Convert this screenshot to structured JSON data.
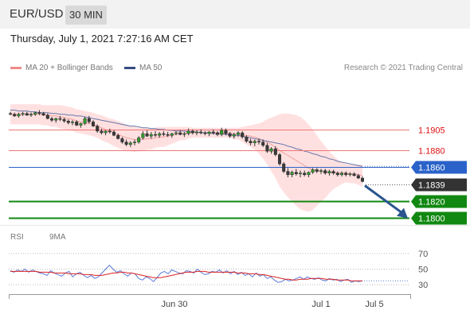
{
  "header": {
    "pair": "EUR/USD",
    "timeframe": "30 MIN"
  },
  "datetime": "Thursday, July 1, 2021 7:27:16 AM CET",
  "legend": {
    "ma_bollinger": "MA 20 + Bollinger Bands",
    "ma50": "MA 50",
    "credit": "Research © 2021 Trading Central"
  },
  "rsi_legend": {
    "rsi": "RSI",
    "ma": "9MA"
  },
  "colors": {
    "up": "#2e9b2e",
    "down": "#3a3a3a",
    "resistance": "#ee7777",
    "pivot": "#2a62c9",
    "support": "#118811",
    "current": "#333333",
    "bollinger_fill": "#ffd6d6",
    "ma50": "#6677aa",
    "rsi_line": "#5b7bd5",
    "rsi_ma": "#dd2222",
    "arrow": "#2a5590"
  },
  "chart_data": {
    "type": "candlestick",
    "x_ticks": [
      "Jun 30",
      "Jul 1",
      "Jul 5"
    ],
    "y_ticks": [
      "1.1905",
      "1.1880",
      "1.1860",
      "1.1839",
      "1.1820",
      "1.1800"
    ],
    "ylim": [
      1.1794,
      1.1955
    ],
    "levels": [
      {
        "label": "1.1905",
        "value": 1.1905,
        "kind": "resistance"
      },
      {
        "label": "1.1880",
        "value": 1.188,
        "kind": "resistance"
      },
      {
        "label": "1.1860",
        "value": 1.186,
        "kind": "pivot"
      },
      {
        "label": "1.1839",
        "value": 1.1839,
        "kind": "current"
      },
      {
        "label": "1.1820",
        "value": 1.182,
        "kind": "support"
      },
      {
        "label": "1.1800",
        "value": 1.18,
        "kind": "support"
      }
    ],
    "candles": [
      [
        1.1924,
        1.1926,
        1.1922,
        1.1923
      ],
      [
        1.1923,
        1.1925,
        1.192,
        1.1921
      ],
      [
        1.1921,
        1.1925,
        1.1919,
        1.1923
      ],
      [
        1.1923,
        1.1926,
        1.1921,
        1.1924
      ],
      [
        1.1924,
        1.1926,
        1.1921,
        1.1922
      ],
      [
        1.1922,
        1.1925,
        1.192,
        1.1923
      ],
      [
        1.1923,
        1.1926,
        1.1921,
        1.1925
      ],
      [
        1.1925,
        1.1928,
        1.1922,
        1.1924
      ],
      [
        1.1924,
        1.1926,
        1.1921,
        1.1922
      ],
      [
        1.1922,
        1.1924,
        1.1917,
        1.1918
      ],
      [
        1.1918,
        1.192,
        1.1914,
        1.1916
      ],
      [
        1.1916,
        1.1919,
        1.1913,
        1.1918
      ],
      [
        1.1918,
        1.1921,
        1.1915,
        1.1917
      ],
      [
        1.1917,
        1.1919,
        1.1913,
        1.1915
      ],
      [
        1.1915,
        1.1917,
        1.1911,
        1.1913
      ],
      [
        1.1913,
        1.1916,
        1.191,
        1.1914
      ],
      [
        1.1914,
        1.1916,
        1.1909,
        1.191
      ],
      [
        1.191,
        1.1913,
        1.1907,
        1.1912
      ],
      [
        1.1912,
        1.192,
        1.191,
        1.1918
      ],
      [
        1.1918,
        1.1921,
        1.1912,
        1.1914
      ],
      [
        1.1914,
        1.1916,
        1.1908,
        1.1909
      ],
      [
        1.1909,
        1.1911,
        1.1901,
        1.1903
      ],
      [
        1.1903,
        1.1906,
        1.1899,
        1.1901
      ],
      [
        1.1901,
        1.1904,
        1.1898,
        1.1903
      ],
      [
        1.1903,
        1.1906,
        1.19,
        1.1902
      ],
      [
        1.1902,
        1.1904,
        1.1897,
        1.1898
      ],
      [
        1.1898,
        1.19,
        1.1893,
        1.1894
      ],
      [
        1.1894,
        1.1896,
        1.1888,
        1.189
      ],
      [
        1.189,
        1.1893,
        1.1885,
        1.1887
      ],
      [
        1.1887,
        1.1891,
        1.1884,
        1.1889
      ],
      [
        1.1889,
        1.1893,
        1.1886,
        1.189
      ],
      [
        1.189,
        1.1897,
        1.1888,
        1.1895
      ],
      [
        1.1895,
        1.1903,
        1.1893,
        1.19
      ],
      [
        1.19,
        1.1904,
        1.1896,
        1.1897
      ],
      [
        1.1897,
        1.1902,
        1.1894,
        1.1899
      ],
      [
        1.1899,
        1.1903,
        1.1896,
        1.1898
      ],
      [
        1.1898,
        1.1902,
        1.1895,
        1.19
      ],
      [
        1.19,
        1.1903,
        1.1897,
        1.1899
      ],
      [
        1.1899,
        1.1902,
        1.1896,
        1.1898
      ],
      [
        1.1898,
        1.1901,
        1.1895,
        1.19
      ],
      [
        1.19,
        1.1903,
        1.1898,
        1.1901
      ],
      [
        1.1901,
        1.1904,
        1.1898,
        1.1899
      ],
      [
        1.1899,
        1.1902,
        1.1896,
        1.19
      ],
      [
        1.19,
        1.1906,
        1.1898,
        1.1903
      ],
      [
        1.1903,
        1.1905,
        1.1899,
        1.1901
      ],
      [
        1.1901,
        1.1904,
        1.1898,
        1.1902
      ],
      [
        1.1902,
        1.1905,
        1.1899,
        1.1901
      ],
      [
        1.1901,
        1.1903,
        1.1898,
        1.19
      ],
      [
        1.19,
        1.1903,
        1.1897,
        1.1902
      ],
      [
        1.1902,
        1.1905,
        1.1899,
        1.1901
      ],
      [
        1.1901,
        1.1903,
        1.1897,
        1.1899
      ],
      [
        1.1899,
        1.1907,
        1.1897,
        1.1904
      ],
      [
        1.1904,
        1.1906,
        1.1898,
        1.19
      ],
      [
        1.19,
        1.1902,
        1.1895,
        1.1897
      ],
      [
        1.1897,
        1.1901,
        1.1894,
        1.1899
      ],
      [
        1.1899,
        1.1903,
        1.1896,
        1.1901
      ],
      [
        1.1901,
        1.1903,
        1.1894,
        1.1896
      ],
      [
        1.1896,
        1.1898,
        1.1889,
        1.1891
      ],
      [
        1.1891,
        1.1894,
        1.1886,
        1.1889
      ],
      [
        1.1889,
        1.1893,
        1.1885,
        1.1891
      ],
      [
        1.1891,
        1.1894,
        1.1887,
        1.189
      ],
      [
        1.189,
        1.1893,
        1.1884,
        1.1886
      ],
      [
        1.1886,
        1.1889,
        1.1877,
        1.1879
      ],
      [
        1.1879,
        1.1884,
        1.1876,
        1.1882
      ],
      [
        1.1882,
        1.1885,
        1.1873,
        1.1875
      ],
      [
        1.1875,
        1.1877,
        1.1862,
        1.1864
      ],
      [
        1.1864,
        1.1866,
        1.1853,
        1.1855
      ],
      [
        1.1855,
        1.1859,
        1.1848,
        1.1851
      ],
      [
        1.1851,
        1.1856,
        1.1848,
        1.1854
      ],
      [
        1.1854,
        1.1858,
        1.185,
        1.1852
      ],
      [
        1.1852,
        1.1856,
        1.1848,
        1.1853
      ],
      [
        1.1853,
        1.1856,
        1.1849,
        1.1851
      ],
      [
        1.1851,
        1.1855,
        1.1848,
        1.1854
      ],
      [
        1.1854,
        1.1859,
        1.1852,
        1.1857
      ],
      [
        1.1857,
        1.1859,
        1.1853,
        1.1855
      ],
      [
        1.1855,
        1.1858,
        1.1852,
        1.1856
      ],
      [
        1.1856,
        1.1858,
        1.1851,
        1.1853
      ],
      [
        1.1853,
        1.1857,
        1.185,
        1.1855
      ],
      [
        1.1855,
        1.1857,
        1.1851,
        1.1853
      ],
      [
        1.1853,
        1.1855,
        1.1849,
        1.1851
      ],
      [
        1.1851,
        1.1855,
        1.1849,
        1.1853
      ],
      [
        1.1853,
        1.1855,
        1.1849,
        1.1851
      ],
      [
        1.1851,
        1.1854,
        1.1849,
        1.1852
      ],
      [
        1.1852,
        1.1854,
        1.1849,
        1.185
      ],
      [
        1.185,
        1.1852,
        1.1846,
        1.1847
      ],
      [
        1.1847,
        1.1849,
        1.1842,
        1.1843
      ]
    ],
    "bollinger": [
      [
        1.1935,
        1.1923,
        1.1911
      ],
      [
        1.1935,
        1.1923,
        1.1911
      ],
      [
        1.1935,
        1.1923,
        1.1911
      ],
      [
        1.1935,
        1.1923,
        1.1911
      ],
      [
        1.1935,
        1.1923,
        1.1911
      ],
      [
        1.1935,
        1.1923,
        1.1911
      ],
      [
        1.1935,
        1.1923,
        1.1911
      ],
      [
        1.1935,
        1.1923,
        1.1911
      ],
      [
        1.1934,
        1.1922,
        1.191
      ],
      [
        1.1934,
        1.1922,
        1.191
      ],
      [
        1.1934,
        1.1921,
        1.1908
      ],
      [
        1.1934,
        1.1921,
        1.1908
      ],
      [
        1.1934,
        1.192,
        1.1906
      ],
      [
        1.1933,
        1.1919,
        1.1905
      ],
      [
        1.1932,
        1.1918,
        1.1904
      ],
      [
        1.1931,
        1.1917,
        1.1903
      ],
      [
        1.1929,
        1.1915,
        1.1901
      ],
      [
        1.1928,
        1.1914,
        1.19
      ],
      [
        1.1927,
        1.1913,
        1.1899
      ],
      [
        1.1926,
        1.1912,
        1.1898
      ],
      [
        1.1925,
        1.1911,
        1.1897
      ],
      [
        1.1923,
        1.1909,
        1.1895
      ],
      [
        1.1922,
        1.1907,
        1.1892
      ],
      [
        1.192,
        1.1905,
        1.189
      ],
      [
        1.1918,
        1.1903,
        1.1888
      ],
      [
        1.1917,
        1.1901,
        1.1885
      ],
      [
        1.1915,
        1.1899,
        1.1883
      ],
      [
        1.1913,
        1.1897,
        1.1881
      ],
      [
        1.1911,
        1.1895,
        1.1879
      ],
      [
        1.1909,
        1.1894,
        1.1879
      ],
      [
        1.1908,
        1.1893,
        1.1878
      ],
      [
        1.1907,
        1.1893,
        1.1879
      ],
      [
        1.1907,
        1.1893,
        1.1879
      ],
      [
        1.1907,
        1.1894,
        1.1881
      ],
      [
        1.1907,
        1.1894,
        1.1881
      ],
      [
        1.1907,
        1.1895,
        1.1883
      ],
      [
        1.1908,
        1.1896,
        1.1884
      ],
      [
        1.1908,
        1.1896,
        1.1884
      ],
      [
        1.1908,
        1.1897,
        1.1886
      ],
      [
        1.1908,
        1.1898,
        1.1888
      ],
      [
        1.1908,
        1.1899,
        1.189
      ],
      [
        1.1908,
        1.19,
        1.1892
      ],
      [
        1.1908,
        1.19,
        1.1892
      ],
      [
        1.1908,
        1.1901,
        1.1894
      ],
      [
        1.1907,
        1.1901,
        1.1895
      ],
      [
        1.1907,
        1.1901,
        1.1895
      ],
      [
        1.1907,
        1.1901,
        1.1895
      ],
      [
        1.1907,
        1.1901,
        1.1895
      ],
      [
        1.1907,
        1.1901,
        1.1895
      ],
      [
        1.1907,
        1.1901,
        1.1895
      ],
      [
        1.1907,
        1.1901,
        1.1895
      ],
      [
        1.1907,
        1.1901,
        1.1895
      ],
      [
        1.1907,
        1.1901,
        1.1895
      ],
      [
        1.1907,
        1.1901,
        1.1895
      ],
      [
        1.1907,
        1.19,
        1.1893
      ],
      [
        1.1907,
        1.19,
        1.1893
      ],
      [
        1.1908,
        1.1899,
        1.189
      ],
      [
        1.1909,
        1.1898,
        1.1887
      ],
      [
        1.191,
        1.1897,
        1.1884
      ],
      [
        1.1911,
        1.1896,
        1.1881
      ],
      [
        1.1912,
        1.1894,
        1.1876
      ],
      [
        1.1914,
        1.1892,
        1.187
      ],
      [
        1.1917,
        1.189,
        1.1863
      ],
      [
        1.1919,
        1.1887,
        1.1855
      ],
      [
        1.1921,
        1.1884,
        1.1847
      ],
      [
        1.1923,
        1.188,
        1.1837
      ],
      [
        1.1924,
        1.1877,
        1.183
      ],
      [
        1.1924,
        1.1874,
        1.1824
      ],
      [
        1.1923,
        1.1871,
        1.1819
      ],
      [
        1.1922,
        1.1868,
        1.1814
      ],
      [
        1.192,
        1.1865,
        1.181
      ],
      [
        1.1916,
        1.1862,
        1.1808
      ],
      [
        1.1911,
        1.1859,
        1.1807
      ],
      [
        1.1905,
        1.1857,
        1.1809
      ],
      [
        1.1898,
        1.1856,
        1.1814
      ],
      [
        1.1891,
        1.1855,
        1.1819
      ],
      [
        1.1885,
        1.1854,
        1.1823
      ],
      [
        1.1879,
        1.1854,
        1.1829
      ],
      [
        1.1874,
        1.1854,
        1.1834
      ],
      [
        1.1869,
        1.1853,
        1.1837
      ],
      [
        1.1866,
        1.1853,
        1.184
      ],
      [
        1.1864,
        1.1853,
        1.1842
      ],
      [
        1.1863,
        1.1852,
        1.1841
      ],
      [
        1.1863,
        1.1852,
        1.1841
      ],
      [
        1.1863,
        1.1851,
        1.1839
      ],
      [
        1.1863,
        1.185,
        1.1837
      ]
    ],
    "ma50": [
      1.1928,
      1.1928,
      1.1927,
      1.1927,
      1.1927,
      1.1926,
      1.1926,
      1.1925,
      1.1925,
      1.1925,
      1.1924,
      1.1924,
      1.1923,
      1.1923,
      1.1922,
      1.1922,
      1.1921,
      1.1921,
      1.192,
      1.1919,
      1.1918,
      1.1917,
      1.1916,
      1.1915,
      1.1914,
      1.1913,
      1.1912,
      1.1911,
      1.191,
      1.1909,
      1.1909,
      1.1908,
      1.1907,
      1.1907,
      1.1906,
      1.1906,
      1.1905,
      1.1905,
      1.1904,
      1.1904,
      1.1903,
      1.1903,
      1.1903,
      1.1902,
      1.1902,
      1.1902,
      1.1901,
      1.1901,
      1.1901,
      1.19,
      1.19,
      1.19,
      1.1899,
      1.1899,
      1.1898,
      1.1898,
      1.1897,
      1.1896,
      1.1895,
      1.1894,
      1.1893,
      1.1892,
      1.1891,
      1.189,
      1.1889,
      1.1888,
      1.1887,
      1.1885,
      1.1884,
      1.1882,
      1.1881,
      1.1879,
      1.1878,
      1.1876,
      1.1875,
      1.1873,
      1.1872,
      1.187,
      1.1869,
      1.1867,
      1.1866,
      1.1865,
      1.1864,
      1.1863,
      1.1862,
      1.1861
    ],
    "forecast": {
      "from": 1.1839,
      "to": 1.18
    },
    "rsi": {
      "ticks": [
        "70",
        "50",
        "30"
      ],
      "ylim": [
        20,
        80
      ],
      "rsi": [
        48,
        46,
        49,
        47,
        50,
        46,
        49,
        47,
        45,
        44,
        42,
        48,
        45,
        43,
        41,
        45,
        47,
        40,
        44,
        46,
        42,
        39,
        42,
        38,
        40,
        45,
        50,
        55,
        50,
        46,
        48,
        44,
        41,
        45,
        44,
        38,
        36,
        40,
        38,
        34,
        39,
        45,
        47,
        44,
        49,
        47,
        45,
        44,
        48,
        47,
        45,
        50,
        46,
        43,
        44,
        47,
        46,
        49,
        45,
        48,
        44,
        47,
        43,
        46,
        42,
        44,
        40,
        45,
        41,
        43,
        38,
        40,
        36,
        33,
        34,
        37,
        35,
        36,
        38,
        40,
        37,
        40,
        38,
        37,
        39,
        36,
        35,
        38,
        36,
        37,
        34,
        36,
        37,
        33,
        35,
        34,
        35
      ],
      "ma": [
        47,
        47,
        47,
        47,
        47,
        47,
        47,
        47,
        46,
        46,
        46,
        46,
        45,
        45,
        45,
        45,
        44,
        44,
        44,
        44,
        43,
        43,
        43,
        42,
        42,
        42,
        43,
        44,
        45,
        45,
        46,
        46,
        45,
        45,
        44,
        43,
        42,
        41,
        40,
        39,
        39,
        39,
        40,
        41,
        42,
        43,
        44,
        45,
        46,
        46,
        46,
        47,
        47,
        47,
        46,
        46,
        46,
        46,
        46,
        46,
        46,
        46,
        45,
        45,
        45,
        44,
        44,
        44,
        43,
        43,
        42,
        41,
        40,
        39,
        38,
        37,
        37,
        36,
        36,
        37,
        37,
        37,
        38,
        38,
        38,
        38,
        37,
        37,
        37,
        36,
        36,
        36,
        36,
        35,
        35,
        35,
        35
      ]
    }
  }
}
